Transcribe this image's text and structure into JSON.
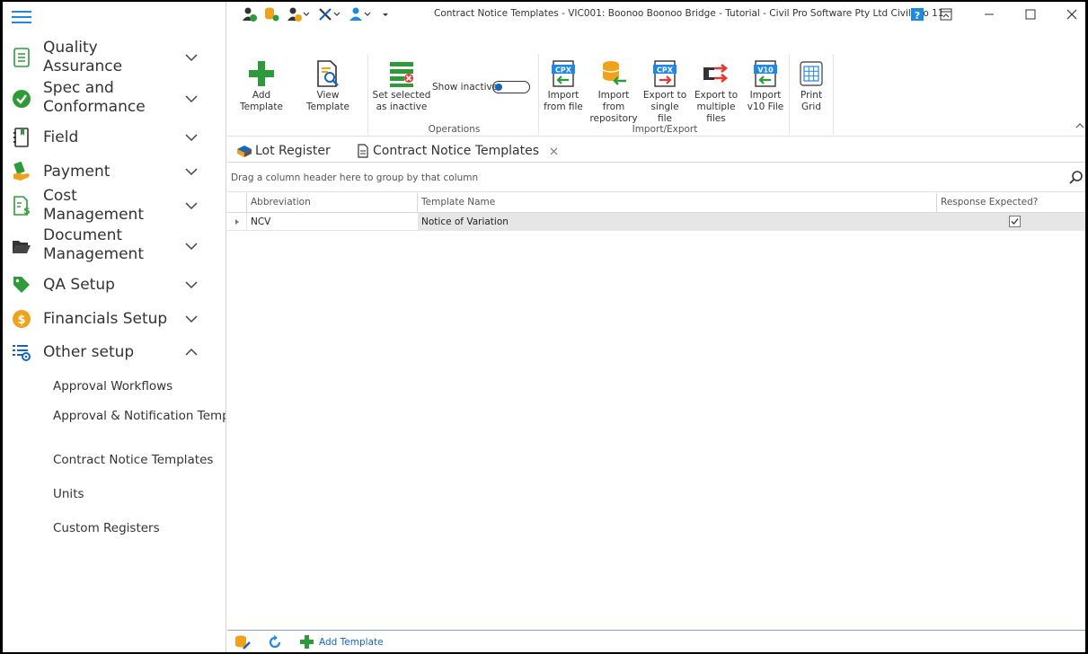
{
  "window": {
    "title": "Contract Notice Templates - VIC001: Boonoo Boonoo Bridge - Tutorial - Civil Pro Software Pty Ltd Civil Pro 11"
  },
  "sidebar": {
    "items": [
      {
        "label": "Quality Assurance",
        "icon": "clipboard-list-icon",
        "expanded": false
      },
      {
        "label": "Spec and Conformance",
        "icon": "checkmark-circle-icon",
        "expanded": false
      },
      {
        "label": "Field",
        "icon": "field-book-icon",
        "expanded": false
      },
      {
        "label": "Payment",
        "icon": "payment-hand-icon",
        "expanded": false
      },
      {
        "label": "Cost Management",
        "icon": "cost-document-icon",
        "expanded": false
      },
      {
        "label": "Document Management",
        "icon": "folder-open-icon",
        "expanded": false
      },
      {
        "label": "QA Setup",
        "icon": "tag-icon",
        "expanded": false
      },
      {
        "label": "Financials Setup",
        "icon": "dollar-coin-icon",
        "expanded": false
      },
      {
        "label": "Other setup",
        "icon": "settings-list-icon",
        "expanded": true
      }
    ],
    "subitems": [
      "Approval Workflows",
      "Approval & Notification Templates",
      "Contract Notice Templates",
      "Units",
      "Custom Registers"
    ]
  },
  "ribbon": {
    "add_template": "Add Template",
    "view_template": "View Template",
    "set_inactive": "Set selected\nas inactive",
    "show_inactive": "Show inactive",
    "operations_label": "Operations",
    "import_file": "Import\nfrom file",
    "import_repo": "Import from\nrepository",
    "export_single": "Export to\nsingle file",
    "export_multiple": "Export to\nmultiple files",
    "import_v10": "Import\nv10 File",
    "import_export_label": "Import/Export",
    "print_grid": "Print\nGrid",
    "cpx": "CPX",
    "v10": "V10"
  },
  "tabs": [
    {
      "label": "Lot Register",
      "icon": "lot-register-icon"
    },
    {
      "label": "Contract Notice Templates",
      "icon": "document-icon",
      "closable": true
    }
  ],
  "grid": {
    "group_hint": "Drag a column header here to group by that column",
    "columns": [
      "Abbreviation",
      "Template Name",
      "Response Expected?"
    ],
    "rows": [
      {
        "abbreviation": "NCV",
        "template_name": "Notice of Variation",
        "response_expected": true
      }
    ]
  },
  "statusbar": {
    "add_template": "Add Template"
  },
  "colors": {
    "accent_blue": "#1e88e5",
    "green": "#2e9b3a",
    "orange": "#f0a21a"
  }
}
